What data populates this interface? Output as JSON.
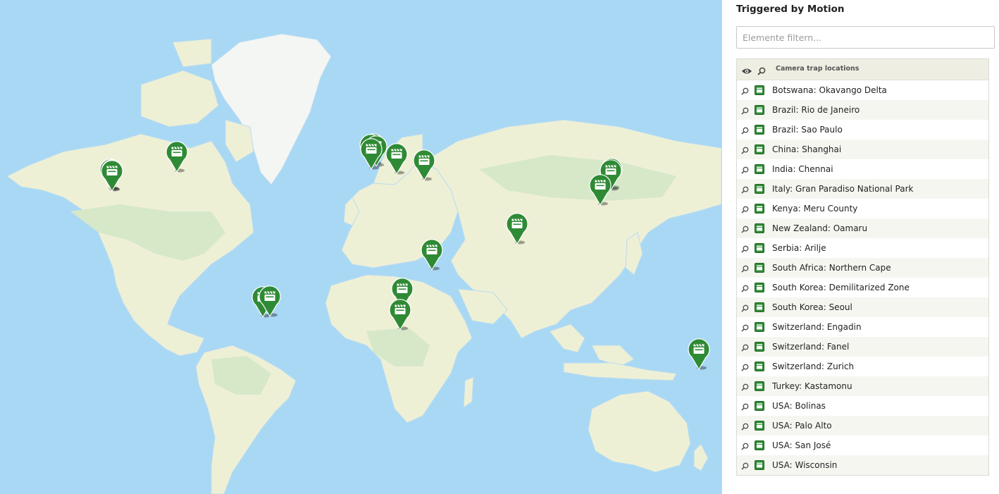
{
  "panel": {
    "title": "Triggered by Motion",
    "filter_placeholder": "Elemente filtern...",
    "layer_title": "Camera trap locations",
    "items": [
      {
        "label": "Botswana: Okavango Delta"
      },
      {
        "label": "Brazil: Rio de Janeiro"
      },
      {
        "label": "Brazil: Sao Paulo"
      },
      {
        "label": "China: Shanghai"
      },
      {
        "label": "India: Chennai"
      },
      {
        "label": "Italy: Gran Paradiso National Park"
      },
      {
        "label": "Kenya: Meru County"
      },
      {
        "label": "New Zealand: Oamaru"
      },
      {
        "label": "Serbia: Arilje"
      },
      {
        "label": "South Africa: Northern Cape"
      },
      {
        "label": "South Korea: Demilitarized Zone"
      },
      {
        "label": "South Korea: Seoul"
      },
      {
        "label": "Switzerland: Engadin"
      },
      {
        "label": "Switzerland: Fanel"
      },
      {
        "label": "Switzerland: Zurich"
      },
      {
        "label": "Turkey: Kastamonu"
      },
      {
        "label": "USA: Bolinas"
      },
      {
        "label": "USA: Palo Alto"
      },
      {
        "label": "USA: San José"
      },
      {
        "label": "USA: Wisconsin"
      }
    ]
  },
  "map": {
    "markers": [
      {
        "name": "marker-usa-bolinas",
        "lat": 37.9,
        "lon": -122.7
      },
      {
        "name": "marker-usa-palo-alto",
        "lat": 37.4,
        "lon": -122.1
      },
      {
        "name": "marker-usa-san-jose",
        "lat": 37.3,
        "lon": -121.9
      },
      {
        "name": "marker-usa-wisconsin",
        "lat": 44.5,
        "lon": -89.5
      },
      {
        "name": "marker-switzerland-zurich",
        "lat": 47.4,
        "lon": 8.5
      },
      {
        "name": "marker-switzerland-fanel",
        "lat": 47.0,
        "lon": 7.0
      },
      {
        "name": "marker-switzerland-engadin",
        "lat": 46.6,
        "lon": 9.9
      },
      {
        "name": "marker-italy-gran-paradiso",
        "lat": 45.5,
        "lon": 7.3
      },
      {
        "name": "marker-serbia-arilje",
        "lat": 43.8,
        "lon": 20.1
      },
      {
        "name": "marker-turkey-kastamonu",
        "lat": 41.4,
        "lon": 33.8
      },
      {
        "name": "marker-kenya-meru",
        "lat": 0.1,
        "lon": 37.6
      },
      {
        "name": "marker-botswana-okavango",
        "lat": -19.3,
        "lon": 22.9
      },
      {
        "name": "marker-south-africa-northern-cape",
        "lat": -29.0,
        "lon": 21.9
      },
      {
        "name": "marker-india-chennai",
        "lat": 13.1,
        "lon": 80.3
      },
      {
        "name": "marker-south-korea-dmz",
        "lat": 38.0,
        "lon": 127.3
      },
      {
        "name": "marker-south-korea-seoul",
        "lat": 37.6,
        "lon": 127.0
      },
      {
        "name": "marker-china-shanghai",
        "lat": 31.2,
        "lon": 121.5
      },
      {
        "name": "marker-brazil-sao-paulo",
        "lat": -23.5,
        "lon": -46.6
      },
      {
        "name": "marker-brazil-rio",
        "lat": -22.9,
        "lon": -43.2
      },
      {
        "name": "marker-new-zealand-oamaru",
        "lat": -45.1,
        "lon": 170.97
      }
    ],
    "colors": {
      "ocean": "#a9d8f5",
      "land": "#eef0d6",
      "land_green": "#d6e8c8",
      "ice": "#f4f6f4",
      "marker": "#2f8a35"
    },
    "marker_icon": "film-clapper-icon"
  }
}
